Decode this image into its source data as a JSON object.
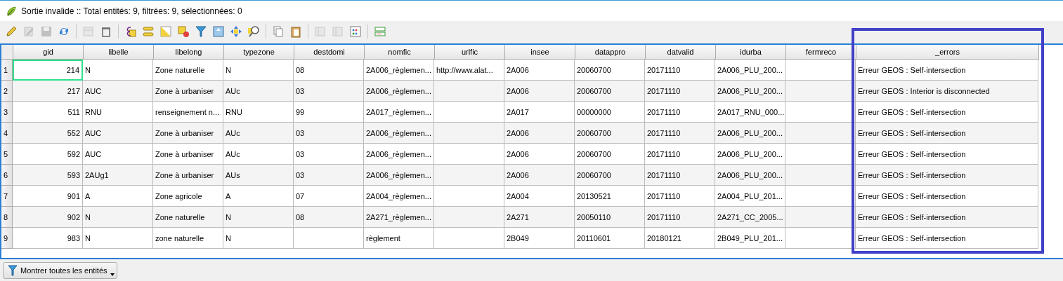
{
  "window": {
    "title": "Sortie invalide :: Total entités: 9, filtrées: 9, sélectionnées: 0"
  },
  "toolbar": {
    "groups": [
      [
        {
          "disabled": false
        },
        {
          "disabled": true
        },
        {
          "disabled": true
        },
        {
          "disabled": false
        }
      ],
      [
        {
          "disabled": true
        },
        {
          "disabled": false
        }
      ],
      [
        {
          "disabled": false
        },
        {
          "disabled": false
        },
        {
          "disabled": false
        },
        {
          "disabled": false
        },
        {
          "disabled": false
        },
        {
          "disabled": false
        },
        {
          "disabled": false
        },
        {
          "disabled": false
        }
      ],
      [
        {
          "disabled": false
        },
        {
          "disabled": false
        }
      ],
      [
        {
          "disabled": true
        },
        {
          "disabled": true
        },
        {
          "disabled": false
        }
      ],
      [
        {
          "disabled": false
        }
      ]
    ]
  },
  "table": {
    "columns": [
      {
        "label": "gid",
        "kind": "number",
        "highlighted": false
      },
      {
        "label": "libelle",
        "kind": "text",
        "highlighted": false
      },
      {
        "label": "libelong",
        "kind": "text",
        "highlighted": false
      },
      {
        "label": "typezone",
        "kind": "text",
        "highlighted": false
      },
      {
        "label": "destdomi",
        "kind": "text",
        "highlighted": false
      },
      {
        "label": "nomfic",
        "kind": "text",
        "highlighted": false
      },
      {
        "label": "urlfic",
        "kind": "text",
        "highlighted": false
      },
      {
        "label": "insee",
        "kind": "text",
        "highlighted": false
      },
      {
        "label": "datappro",
        "kind": "text",
        "highlighted": false
      },
      {
        "label": "datvalid",
        "kind": "text",
        "highlighted": false
      },
      {
        "label": "idurba",
        "kind": "text",
        "highlighted": false
      },
      {
        "label": "fermreco",
        "kind": "text",
        "highlighted": false
      },
      {
        "label": "_errors",
        "kind": "wide",
        "highlighted": true
      }
    ],
    "rows": [
      {
        "number": "1",
        "current": true,
        "cells": [
          "214",
          "N",
          "Zone naturelle",
          "N",
          "08",
          "2A006_règlemen...",
          "http://www.alat...",
          "2A006",
          "20060700",
          "20171110",
          "2A006_PLU_200...",
          "",
          "Erreur GEOS : Self-intersection"
        ]
      },
      {
        "number": "2",
        "current": false,
        "cells": [
          "217",
          "AUC",
          "Zone à urbaniser",
          "AUc",
          "03",
          "2A006_règlemen...",
          "",
          "2A006",
          "20060700",
          "20171110",
          "2A006_PLU_200...",
          "",
          "Erreur GEOS : Interior is disconnected"
        ]
      },
      {
        "number": "3",
        "current": false,
        "cells": [
          "511",
          "RNU",
          "renseignement n...",
          "RNU",
          "99",
          "2A017_règlemen...",
          "",
          "2A017",
          "00000000",
          "20171110",
          "2A017_RNU_000...",
          "",
          "Erreur GEOS : Self-intersection"
        ]
      },
      {
        "number": "4",
        "current": false,
        "cells": [
          "552",
          "AUC",
          "Zone à urbaniser",
          "AUc",
          "03",
          "2A006_règlemen...",
          "",
          "2A006",
          "20060700",
          "20171110",
          "2A006_PLU_200...",
          "",
          "Erreur GEOS : Self-intersection"
        ]
      },
      {
        "number": "5",
        "current": false,
        "cells": [
          "592",
          "AUC",
          "Zone à urbaniser",
          "AUc",
          "03",
          "2A006_règlemen...",
          "",
          "2A006",
          "20060700",
          "20171110",
          "2A006_PLU_200...",
          "",
          "Erreur GEOS : Self-intersection"
        ]
      },
      {
        "number": "6",
        "current": false,
        "cells": [
          "593",
          "2AUg1",
          "Zone à urbaniser",
          "AUs",
          "03",
          "2A006_règlemen...",
          "",
          "2A006",
          "20060700",
          "20171110",
          "2A006_PLU_200...",
          "",
          "Erreur GEOS : Self-intersection"
        ]
      },
      {
        "number": "7",
        "current": false,
        "cells": [
          "901",
          "A",
          "Zone agricole",
          "A",
          "07",
          "2A004_règlemen...",
          "",
          "2A004",
          "20130521",
          "20171110",
          "2A004_PLU_201...",
          "",
          "Erreur GEOS : Self-intersection"
        ]
      },
      {
        "number": "8",
        "current": false,
        "cells": [
          "902",
          "N",
          "Zone naturelle",
          "N",
          "08",
          "2A271_règlemen...",
          "",
          "2A271",
          "20050110",
          "20171110",
          "2A271_CC_2005...",
          "",
          "Erreur GEOS : Self-intersection"
        ]
      },
      {
        "number": "9",
        "current": false,
        "cells": [
          "983",
          "N",
          "zone naturelle",
          "N",
          "",
          "règlement",
          "",
          "2B049",
          "20110601",
          "20180121",
          "2B049_PLU_201...",
          "",
          "Erreur GEOS : Self-intersection"
        ]
      }
    ]
  },
  "filter_button": {
    "label": "Montrer toutes les entités"
  }
}
